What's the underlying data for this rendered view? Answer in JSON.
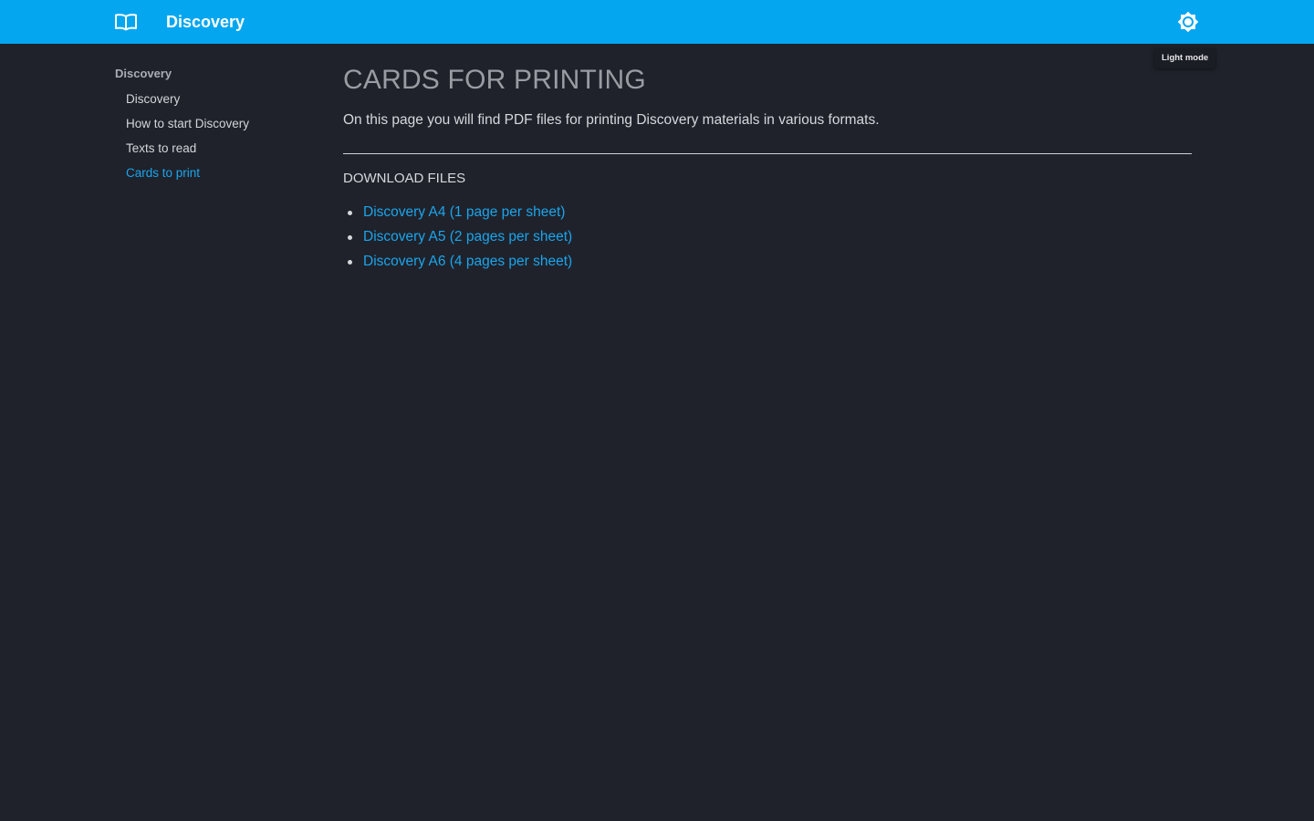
{
  "header": {
    "logo_icon": "book-open-icon",
    "title": "Discovery",
    "theme_toggle_icon": "sun-brightness-icon",
    "theme_tooltip": "Light mode",
    "background_color": "#04a6f0"
  },
  "sidebar": {
    "heading": "Discovery",
    "items": [
      {
        "label": "Discovery",
        "active": false
      },
      {
        "label": "How to start Discovery",
        "active": false
      },
      {
        "label": "Texts to read",
        "active": false
      },
      {
        "label": "Cards to print",
        "active": true
      }
    ],
    "active_color": "#1ba5ec"
  },
  "main": {
    "title": "CARDS FOR PRINTING",
    "intro": "On this page you will find PDF files for printing Discovery materials in various formats.",
    "section_title": "DOWNLOAD FILES",
    "downloads": [
      {
        "label": "Discovery A4 (1 page per sheet)"
      },
      {
        "label": "Discovery A5 (2 pages per sheet)"
      },
      {
        "label": "Discovery A6 (4 pages per sheet)"
      }
    ],
    "link_color": "#1ba5ec"
  },
  "page_background": "#1f222b"
}
